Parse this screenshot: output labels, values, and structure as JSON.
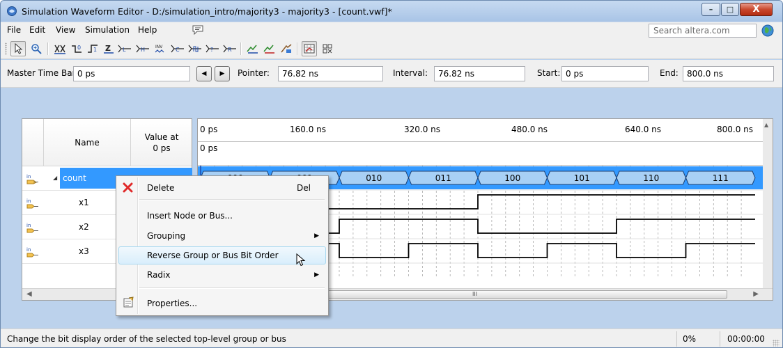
{
  "window": {
    "title": "Simulation Waveform Editor - D:/simulation_intro/majority3 - majority3 - [count.vwf]*",
    "minimize": "–",
    "maximize": "□",
    "close": "X"
  },
  "menu": {
    "items": [
      "File",
      "Edit",
      "View",
      "Simulation",
      "Help"
    ],
    "search_placeholder": "Search altera.com"
  },
  "toolbar": {
    "tools": [
      "selection-tool",
      "zoom-tool",
      "forcing-unknown-tool",
      "forcing-low-tool",
      "forcing-high-tool",
      "high-impedance-tool",
      "weak-low-tool",
      "weak-high-tool",
      "invert-tool",
      "count-value-tool",
      "clock-tool",
      "random-values-tool",
      "arbitrary-value-tool",
      "run-functional-simulation",
      "run-timing-simulation",
      "generate-netlist",
      "snap-to-grid",
      "grid-settings"
    ]
  },
  "timebar": {
    "master_label": "Master Time Bar:",
    "master_value": "0 ps",
    "pointer_label": "Pointer:",
    "pointer_value": "76.82 ns",
    "interval_label": "Interval:",
    "interval_value": "76.82 ns",
    "start_label": "Start:",
    "start_value": "0 ps",
    "end_label": "End:",
    "end_value": "800.0 ns",
    "prev_label": "◀",
    "next_label": "▶"
  },
  "grid": {
    "col_name": "Name",
    "col_value_line1": "Value at",
    "col_value_line2": "0 ps",
    "rows": [
      {
        "name": "count",
        "type": "bus"
      },
      {
        "name": "x1",
        "type": "input"
      },
      {
        "name": "x2",
        "type": "input"
      },
      {
        "name": "x3",
        "type": "input"
      }
    ]
  },
  "waveform": {
    "time_ticks": [
      "0 ps",
      "160.0 ns",
      "320.0 ns",
      "480.0 ns",
      "640.0 ns",
      "800.0 ns"
    ],
    "master_marker": "0 ps",
    "count_values": [
      "000",
      "001",
      "010",
      "011",
      "100",
      "101",
      "110",
      "111"
    ],
    "visible_count_values": [
      "010",
      "011",
      "100",
      "101",
      "110",
      "111"
    ],
    "scroll_grip": "III"
  },
  "context_menu": {
    "items": [
      {
        "label": "Delete",
        "shortcut": "Del",
        "icon": "delete-x-icon"
      },
      {
        "label": "Insert Node or Bus..."
      },
      {
        "label": "Grouping",
        "submenu": true
      },
      {
        "label": "Reverse Group or Bus Bit Order",
        "highlighted": true
      },
      {
        "label": "Radix",
        "submenu": true
      },
      {
        "label": "Properties...",
        "icon": "properties-icon"
      }
    ]
  },
  "status": {
    "message": "Change the bit display order of the selected top-level group or bus",
    "progress": "0%",
    "elapsed": "00:00:00"
  }
}
